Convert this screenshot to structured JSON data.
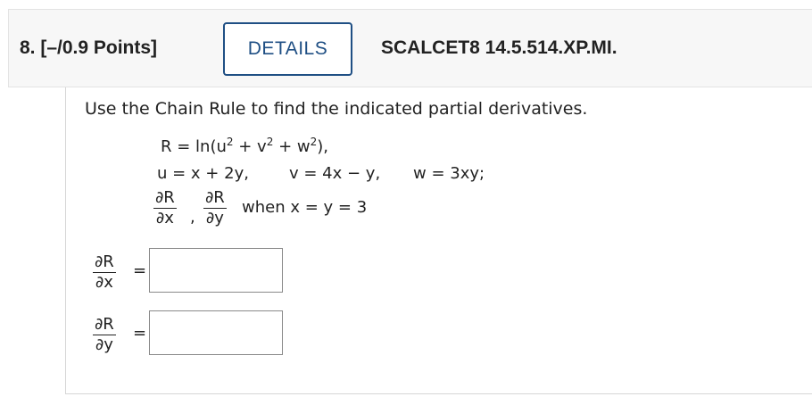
{
  "header": {
    "question_label": "8. [–/0.9 Points]",
    "details_label": "DETAILS",
    "source_label": "SCALCET8 14.5.514.XP.MI."
  },
  "problem": {
    "instruction": "Use the Chain Rule to find the indicated partial derivatives.",
    "line1": {
      "lhs": "R = ln(u",
      "p1": " + v",
      "p2": " + w",
      "p3": "),",
      "exponent": "2"
    },
    "line2": {
      "u": "u = x + 2y,",
      "v": "v = 4x − y,",
      "w": "w = 3xy;"
    },
    "line3": {
      "frac1_num": "∂R",
      "frac1_den": "∂x",
      "comma": ",",
      "frac2_num": "∂R",
      "frac2_den": "∂y",
      "condition": "when x = y = 3"
    }
  },
  "answers": [
    {
      "num": "∂R",
      "den": "∂x",
      "equals": "=",
      "value": ""
    },
    {
      "num": "∂R",
      "den": "∂y",
      "equals": "=",
      "value": ""
    }
  ]
}
